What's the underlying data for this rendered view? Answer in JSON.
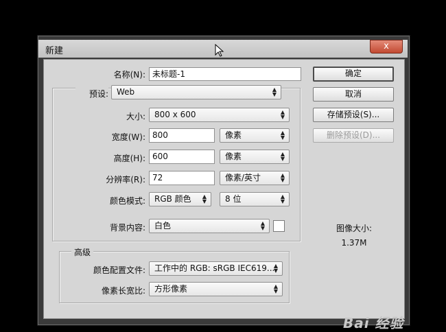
{
  "window": {
    "title": "新建",
    "close_symbol": "x"
  },
  "form": {
    "name_label": "名称(N):",
    "name_value": "未标题-1",
    "preset_label": "预设:",
    "preset_value": "Web",
    "size_label": "大小:",
    "size_value": "800 x 600",
    "width_label": "宽度(W):",
    "width_value": "800",
    "width_unit": "像素",
    "height_label": "高度(H):",
    "height_value": "600",
    "height_unit": "像素",
    "resolution_label": "分辨率(R):",
    "resolution_value": "72",
    "resolution_unit": "像素/英寸",
    "color_mode_label": "颜色模式:",
    "color_mode_value": "RGB 颜色",
    "bit_depth_value": "8 位",
    "background_label": "背景内容:",
    "background_value": "白色",
    "background_swatch": "#ffffff"
  },
  "advanced": {
    "title": "高级",
    "profile_label": "颜色配置文件:",
    "profile_value": "工作中的 RGB: sRGB IEC619...",
    "aspect_label": "像素长宽比:",
    "aspect_value": "方形像素"
  },
  "buttons": {
    "ok": "确定",
    "cancel": "取消",
    "save_preset": "存储预设(S)...",
    "delete_preset": "删除预设(D)..."
  },
  "image_size": {
    "label": "图像大小:",
    "value": "1.37M"
  },
  "watermark": "Bai 经验",
  "icons": {
    "dropdown": "up-down-arrows-icon",
    "cursor": "mouse-pointer-icon"
  }
}
